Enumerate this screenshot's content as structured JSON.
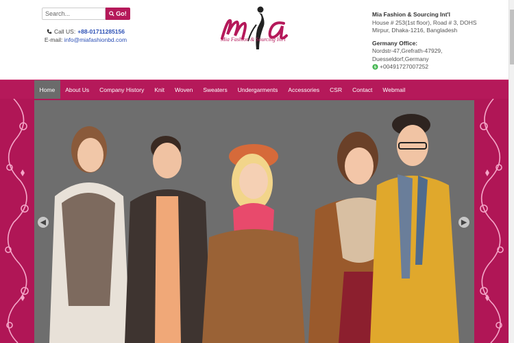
{
  "search": {
    "placeholder": "Search...",
    "button_label": "Go!"
  },
  "contact": {
    "call_label": "Call US:",
    "phone": "+88-01711285156",
    "email_label": "E-mail:",
    "email": "info@miafashionbd.com"
  },
  "logo": {
    "mark": "mia",
    "tagline": "Mia Fashion & Sourcing Int'l"
  },
  "address": {
    "company": "Mia Fashion & Sourcing Int'l",
    "line1": "House # 253(1st floor), Road # 3, DOHS",
    "line2": "Mirpur, Dhaka-1216, Bangladesh",
    "germany_title": "Germany Office:",
    "germany_line1": "Nordstr-47,Grefrath-47929,",
    "germany_line2": "Duesseldorf,Germany",
    "skype": "+00491727007252"
  },
  "nav": {
    "items": [
      {
        "label": "Home"
      },
      {
        "label": "About Us"
      },
      {
        "label": "Company History"
      },
      {
        "label": "Knit"
      },
      {
        "label": "Woven"
      },
      {
        "label": "Sweaters"
      },
      {
        "label": "Undergarments"
      },
      {
        "label": "Accessories"
      },
      {
        "label": "CSR"
      },
      {
        "label": "Contact"
      },
      {
        "label": "Webmail"
      }
    ],
    "active": "Home"
  },
  "colors": {
    "brand": "#b5195a",
    "active_nav": "#6b6b6b",
    "link": "#2b4fb5"
  },
  "icons": [
    "search-icon",
    "phone-icon",
    "skype-icon",
    "arrow-left-icon",
    "arrow-right-icon"
  ]
}
